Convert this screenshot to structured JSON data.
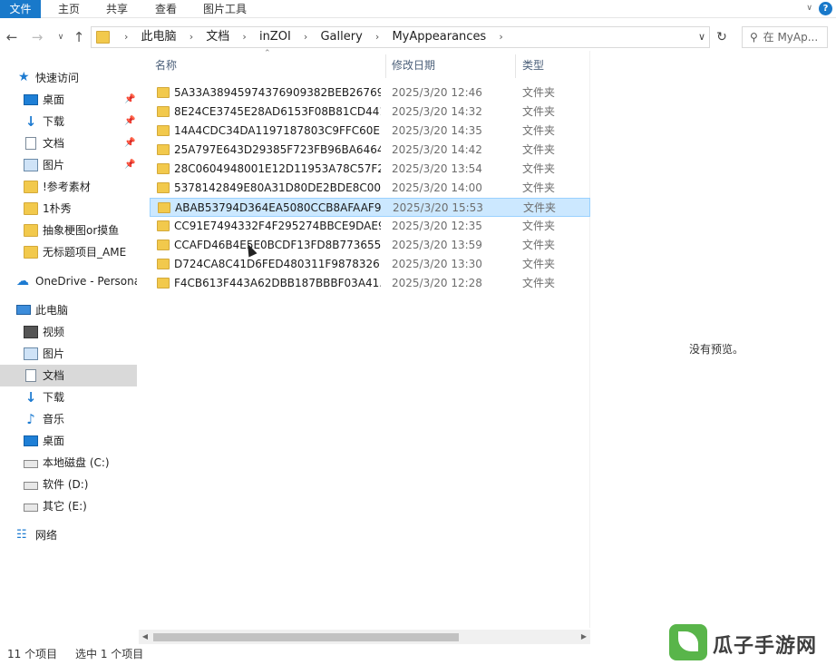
{
  "ribbon": {
    "tabs": [
      "文件",
      "主页",
      "共享",
      "查看",
      "图片工具"
    ],
    "help_label": "?"
  },
  "address": {
    "crumbs": [
      "此电脑",
      "文档",
      "inZOI",
      "Gallery",
      "MyAppearances"
    ],
    "search_placeholder": "在 MyAp..."
  },
  "nav": {
    "quick_access": "快速访问",
    "quick_items": [
      "桌面",
      "下载",
      "文档",
      "图片",
      "!参考素材",
      "1朴秀",
      "抽象梗图or摸鱼",
      "无标题项目_AME"
    ],
    "onedrive": "OneDrive - Persona",
    "this_pc": "此电脑",
    "pc_items": [
      "视频",
      "图片",
      "文档",
      "下载",
      "音乐",
      "桌面",
      "本地磁盘 (C:)",
      "软件 (D:)",
      "其它 (E:)"
    ],
    "network": "网络",
    "selected": "文档"
  },
  "columns": {
    "name": "名称",
    "date": "修改日期",
    "type": "类型"
  },
  "files": [
    {
      "name": "5A33A38945974376909382BEB26769...",
      "date": "2025/3/20 12:46",
      "type": "文件夹"
    },
    {
      "name": "8E24CE3745E28AD6153F08B81CD441...",
      "date": "2025/3/20 14:32",
      "type": "文件夹"
    },
    {
      "name": "14A4CDC34DA1197187803C9FFC60E...",
      "date": "2025/3/20 14:35",
      "type": "文件夹"
    },
    {
      "name": "25A797E643D29385F723FB96BA6464...",
      "date": "2025/3/20 14:42",
      "type": "文件夹"
    },
    {
      "name": "28C0604948001E12D11953A78C57F2...",
      "date": "2025/3/20 13:54",
      "type": "文件夹"
    },
    {
      "name": "5378142849E80A31D80DE2BDE8C00...",
      "date": "2025/3/20 14:00",
      "type": "文件夹"
    },
    {
      "name": "ABAB53794D364EA5080CCB8AFAAF9...",
      "date": "2025/3/20 15:53",
      "type": "文件夹",
      "selected": true
    },
    {
      "name": "CC91E7494332F4F295274BBCE9DAE9...",
      "date": "2025/3/20 12:35",
      "type": "文件夹"
    },
    {
      "name": "CCAFD46B4E5E0BCDF13FD8B773655...",
      "date": "2025/3/20 13:59",
      "type": "文件夹"
    },
    {
      "name": "D724CA8C41D6FED480311F9878326...",
      "date": "2025/3/20 13:30",
      "type": "文件夹"
    },
    {
      "name": "F4CB613F443A62DBB187BBBF03A41...",
      "date": "2025/3/20 12:28",
      "type": "文件夹"
    }
  ],
  "preview": {
    "message": "没有预览。"
  },
  "status": {
    "count": "11 个项目",
    "selected": "选中 1 个项目"
  },
  "watermark": {
    "text": "瓜子手游网"
  }
}
